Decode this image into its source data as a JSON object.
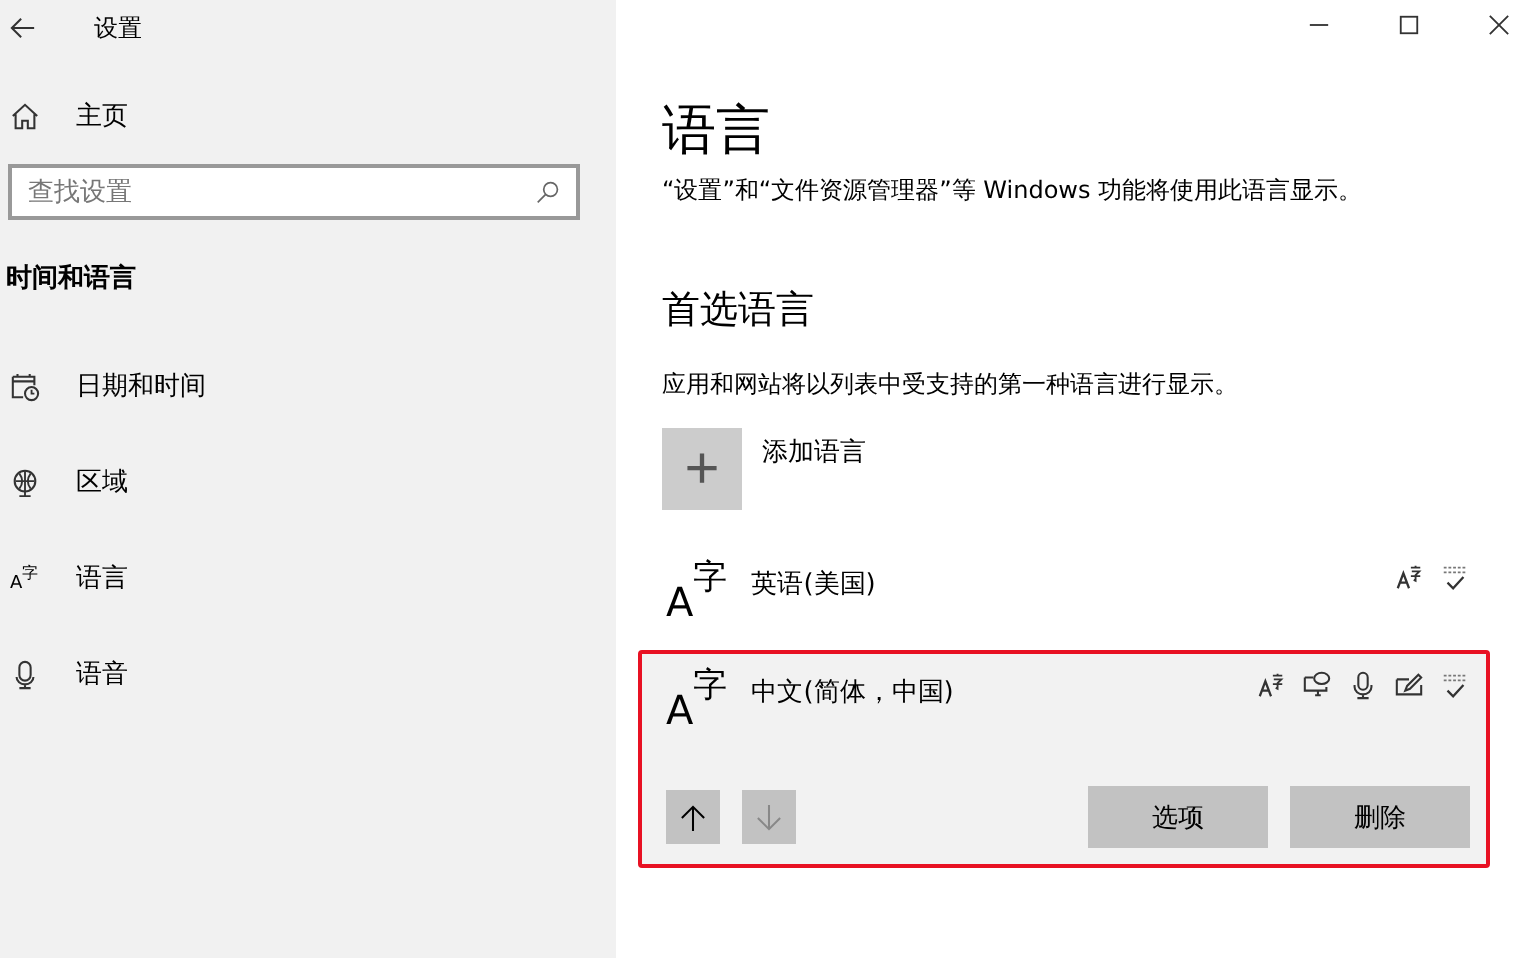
{
  "window": {
    "title": "设置"
  },
  "sidebar": {
    "home": "主页",
    "search": {
      "placeholder": "查找设置"
    },
    "section": "时间和语言",
    "items": [
      {
        "kind": "calendar",
        "label": "日期和时间",
        "selected": false
      },
      {
        "kind": "globe",
        "label": "区域",
        "selected": false
      },
      {
        "kind": "language",
        "label": "语言",
        "selected": false,
        "icon_letter": "A",
        "icon_char": "字"
      },
      {
        "kind": "mic",
        "label": "语音",
        "selected": false
      }
    ]
  },
  "page": {
    "title": "语言",
    "description": "“设置”和“文件资源管理器”等 Windows 功能将使用此语言显示。",
    "section": "首选语言",
    "section_description": "应用和网站将以列表中受支持的第一种语言进行显示。",
    "add_button": {
      "icon": "+",
      "label": "添加语言"
    },
    "languages": [
      {
        "name": "英语(美国)",
        "icon_letter": "A",
        "icon_char": "字",
        "selected": false,
        "features": [
          {
            "kind": "display"
          },
          {
            "kind": "spelling"
          }
        ]
      },
      {
        "name": "中文(简体，中国)",
        "icon_letter": "A",
        "icon_char": "字",
        "selected": true,
        "features": [
          {
            "kind": "display"
          },
          {
            "kind": "tts"
          },
          {
            "kind": "speech"
          },
          {
            "kind": "handwriting"
          },
          {
            "kind": "spelling"
          }
        ],
        "move_up": {
          "disabled": false
        },
        "move_down": {
          "disabled": true
        },
        "buttons": [
          "选项",
          "删除"
        ]
      }
    ]
  }
}
